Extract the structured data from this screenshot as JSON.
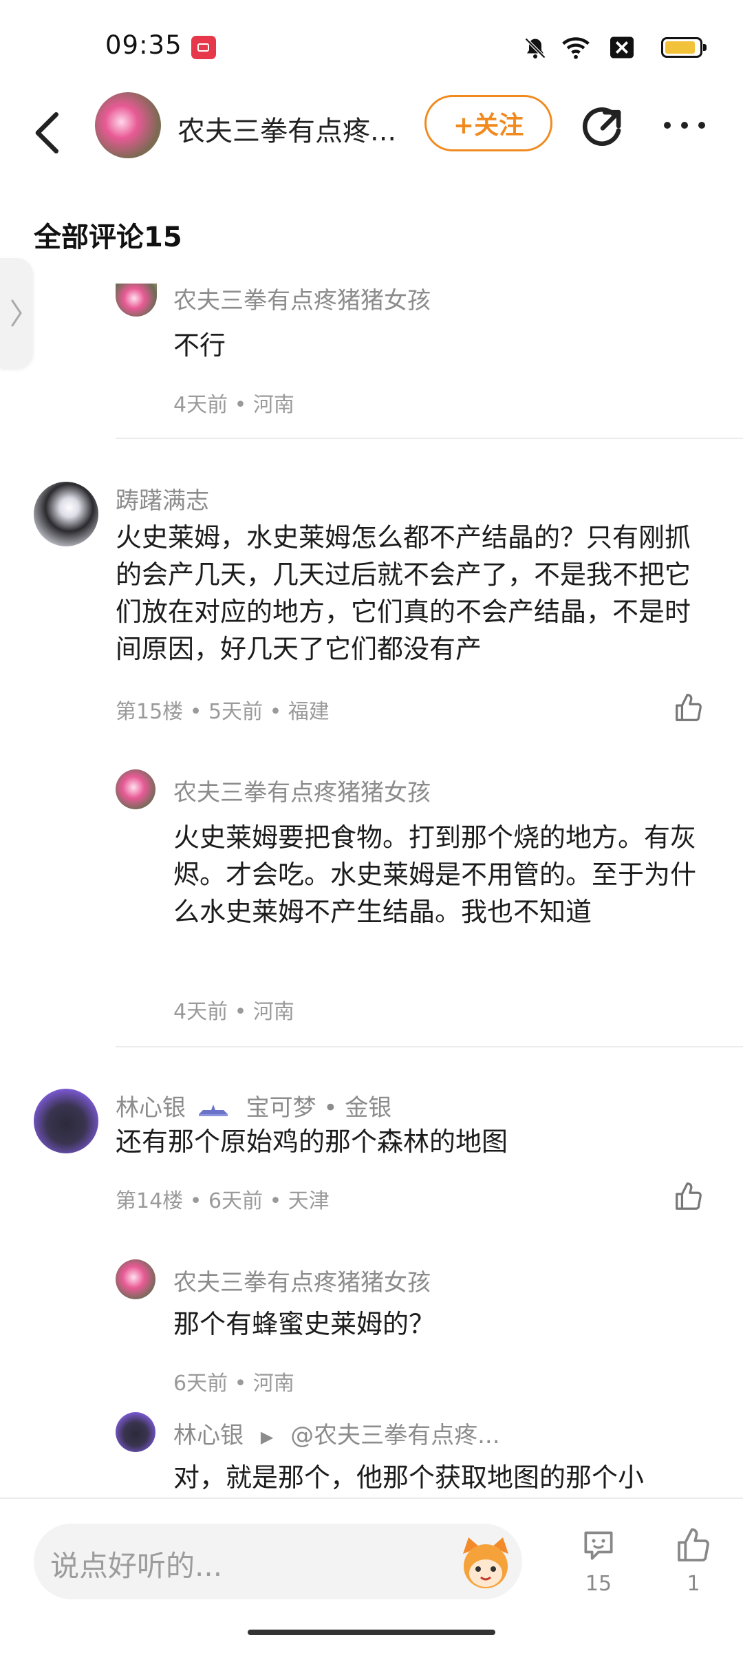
{
  "status": {
    "time": "09:35"
  },
  "header": {
    "title": "农夫三拳有点疼...",
    "follow_label": "+关注"
  },
  "section": {
    "title": "全部评论15"
  },
  "comments": [
    {
      "reply_name": "农夫三拳有点疼猪猪女孩",
      "reply_text": "不行",
      "reply_meta": "4天前 • 河南"
    },
    {
      "name": "踌躇满志",
      "text": "火史莱姆，水史莱姆怎么都不产结晶的？只有刚抓的会产几天，几天过后就不会产了，不是我不把它们放在对应的地方，它们真的不会产结晶，不是时间原因，好几天了它们都没有产",
      "meta": "第15楼 • 5天前 • 福建",
      "reply": {
        "name": "农夫三拳有点疼猪猪女孩",
        "text": "火史莱姆要把食物。打到那个烧的地方。有灰烬。才会吃。水史莱姆是不用管的。至于为什么水史莱姆不产生结晶。我也不知道",
        "meta": "4天前 • 河南"
      }
    },
    {
      "name": "林心银",
      "tag": "宝可梦 • 金银",
      "text": "还有那个原始鸡的那个森林的地图",
      "meta": "第14楼 • 6天前 • 天津",
      "reply": {
        "name": "农夫三拳有点疼猪猪女孩",
        "text": "那个有蜂蜜史莱姆的？",
        "meta": "6天前 • 河南"
      },
      "reply2": {
        "name": "林心银",
        "target": "@农夫三拳有点疼...",
        "text": "对，就是那个，他那个获取地图的那个小"
      }
    }
  ],
  "bottom": {
    "placeholder": "说点好听的...",
    "comment_count": "15",
    "like_count": "1"
  }
}
